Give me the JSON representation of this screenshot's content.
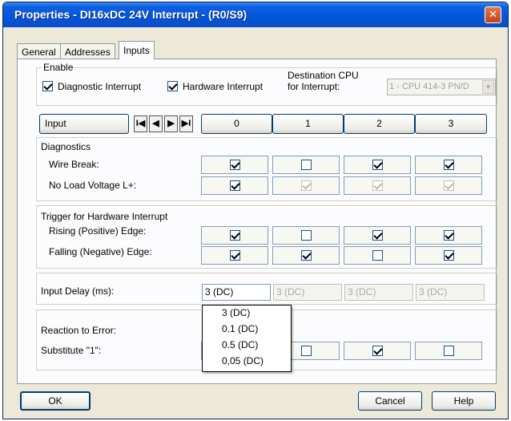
{
  "window": {
    "title": "Properties - DI16xDC 24V Interrupt - (R0/S9)",
    "close_glyph": "✕"
  },
  "tabs": [
    {
      "label": "General"
    },
    {
      "label": "Addresses"
    },
    {
      "label": "Inputs",
      "active": true
    }
  ],
  "enable": {
    "legend": "Enable",
    "diagnostic_interrupt": {
      "label": "Diagnostic Interrupt",
      "checked": true
    },
    "hardware_interrupt": {
      "label": "Hardware Interrupt",
      "checked": true
    },
    "destination_cpu": {
      "label_line1": "Destination CPU",
      "label_line2": "for Interrupt:",
      "value": "1 - CPU 414-3 PN/D",
      "disabled": true
    }
  },
  "grid": {
    "input_header": "Input",
    "nav_first": "I◀",
    "nav_prev": "◀",
    "nav_next": "▶",
    "nav_last": "▶I",
    "columns": [
      "0",
      "1",
      "2",
      "3"
    ]
  },
  "diagnostics": {
    "title": "Diagnostics",
    "wire_break": {
      "label": "Wire Break:",
      "values": [
        true,
        false,
        true,
        true
      ],
      "enabled": [
        true,
        true,
        true,
        true
      ]
    },
    "no_load_voltage": {
      "label": "No Load Voltage L+:",
      "values": [
        true,
        true,
        true,
        true
      ],
      "enabled": [
        true,
        false,
        false,
        false
      ]
    }
  },
  "trigger": {
    "title": "Trigger for Hardware Interrupt",
    "rising_edge": {
      "label": "Rising (Positive) Edge:",
      "values": [
        true,
        false,
        true,
        true
      ]
    },
    "falling_edge": {
      "label": "Falling (Negative) Edge:",
      "values": [
        true,
        true,
        false,
        true
      ]
    }
  },
  "input_delay": {
    "label": "Input Delay (ms):",
    "values": [
      "3 (DC)",
      "3 (DC)",
      "3 (DC)",
      "3 (DC)"
    ],
    "options": [
      "3 (DC)",
      "0.1 (DC)",
      "0.5 (DC)",
      "0,05 (DC)"
    ]
  },
  "reaction": {
    "label": "Reaction to Error:",
    "substitute_label": "Substitute \"1\":",
    "substitute_values": [
      false,
      false,
      true,
      false
    ]
  },
  "footer": {
    "ok": "OK",
    "cancel": "Cancel",
    "help": "Help"
  }
}
